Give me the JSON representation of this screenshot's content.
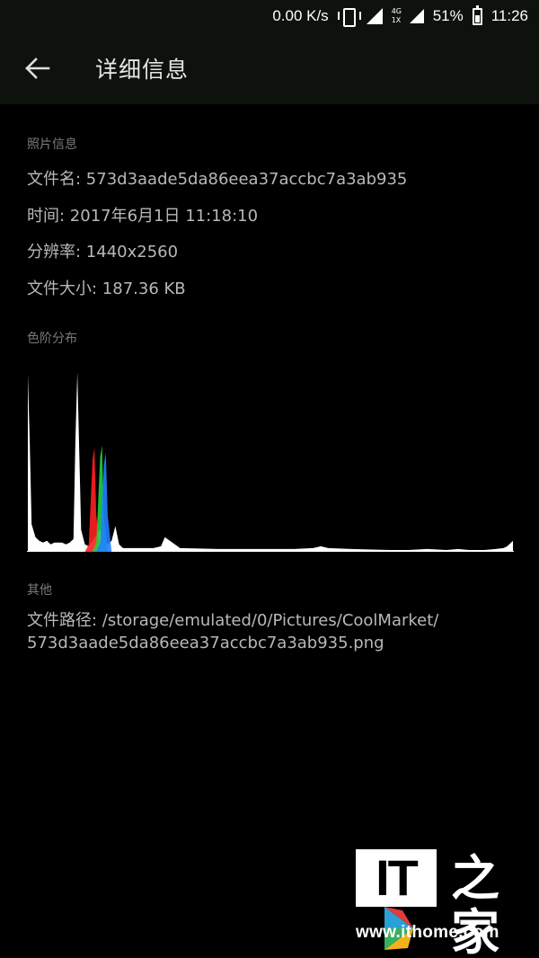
{
  "status_bar": {
    "net_speed": "0.00 K/s",
    "network_type_top": "4G",
    "network_type_bottom": "1X",
    "battery_percent": "51%",
    "battery_level": 0.51,
    "time": "11:26"
  },
  "app_bar": {
    "title": "详细信息",
    "back_icon": "arrow-left-icon"
  },
  "photo_info": {
    "section_title": "照片信息",
    "file_name": "文件名: 573d3aade5da86eea37accbc7a3ab935",
    "time": "时间: 2017年6月1日 11:18:10",
    "resolution": "分辨率: 1440x2560",
    "file_size": "文件大小: 187.36 KB"
  },
  "histogram": {
    "section_title": "色阶分布"
  },
  "chart_data": {
    "type": "area",
    "xlim": [
      0,
      255
    ],
    "ylim": [
      0,
      100
    ],
    "series": [
      {
        "color": "#ffffff",
        "x": [
          0,
          1,
          2,
          4,
          6,
          8,
          10,
          12,
          14,
          16,
          18,
          20,
          22,
          24,
          25,
          26,
          27,
          28,
          30,
          32,
          34,
          36,
          38,
          40,
          42,
          44,
          46,
          48,
          50,
          52,
          54,
          56,
          60,
          66,
          70,
          72,
          80,
          100,
          120,
          140,
          150,
          154,
          158,
          170,
          190,
          200,
          210,
          220,
          226,
          232,
          240,
          246,
          250,
          252,
          254,
          255
        ],
        "y": [
          97,
          60,
          15,
          8,
          6,
          5,
          6,
          4,
          5,
          5,
          5,
          4,
          5,
          7,
          60,
          98,
          55,
          12,
          4,
          3,
          6,
          9,
          12,
          7,
          4,
          6,
          14,
          4,
          2,
          2,
          2,
          2,
          2,
          2,
          3,
          8,
          2,
          1.5,
          1.5,
          1.5,
          2,
          3,
          2,
          1.5,
          1,
          1,
          1.5,
          1,
          1.5,
          1,
          1,
          1.5,
          2,
          3,
          5,
          6
        ]
      },
      {
        "color": "#ff2020",
        "x": [
          30,
          32,
          34,
          35,
          36,
          38
        ],
        "y": [
          0,
          4,
          50,
          57,
          20,
          0
        ]
      },
      {
        "color": "#20d040",
        "x": [
          34,
          36,
          38,
          39,
          40,
          42
        ],
        "y": [
          0,
          5,
          52,
          58,
          18,
          0
        ]
      },
      {
        "color": "#2080ff",
        "x": [
          36,
          38,
          40,
          41,
          42,
          44
        ],
        "y": [
          0,
          5,
          48,
          54,
          20,
          0
        ]
      }
    ]
  },
  "other": {
    "section_title": "其他",
    "path_line1": "文件路径: /storage/emulated/0/Pictures/CoolMarket/",
    "path_line2": "573d3aade5da86eea37accbc7a3ab935.png"
  },
  "watermark": {
    "brand": "IT",
    "url": "www.ithome.com"
  }
}
